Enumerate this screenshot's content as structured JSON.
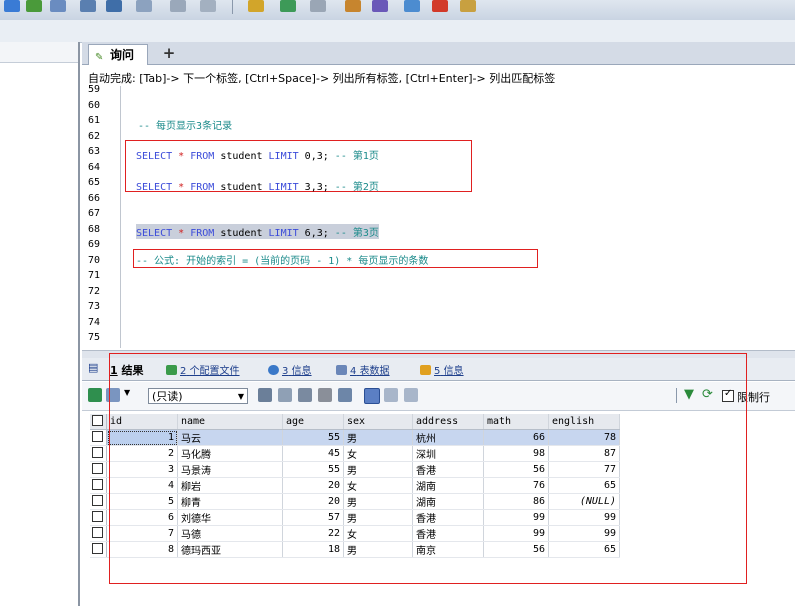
{
  "toolbar": {
    "icons": [
      "db-icon",
      "connect-icon",
      "table-icon",
      "query-icon",
      "backup-icon",
      "restore-icon",
      "schema-icon",
      "check-icon",
      "refresh-icon",
      "grid-icon",
      "user-icon",
      "tools-icon",
      "pdf-icon",
      "chart-icon"
    ]
  },
  "editor": {
    "tab_label": "询问",
    "add_tab": "+",
    "hint": "自动完成: [Tab]-> 下一个标签, [Ctrl+Space]-> 列出所有标签, [Ctrl+Enter]-> 列出匹配标签",
    "line_numbers": [
      "59",
      "60",
      "61",
      "62",
      "63",
      "64",
      "65",
      "66",
      "67",
      "68",
      "69",
      "70",
      "71",
      "72",
      "73",
      "74",
      "75"
    ],
    "comment_line": "-- 每页显示3条记录",
    "q1": {
      "select": "SELECT",
      "star": "*",
      "from": "FROM",
      "table": "student",
      "limit": "LIMIT",
      "args": "0,3;",
      "comment": "-- 第1页"
    },
    "q2": {
      "select": "SELECT",
      "star": "*",
      "from": "FROM",
      "table": "student",
      "limit": "LIMIT",
      "args": "3,3;",
      "comment": "-- 第2页"
    },
    "q3": {
      "select": "SELECT",
      "star": "*",
      "from": "FROM",
      "table": "student",
      "limit": "LIMIT",
      "args": "6,3;",
      "comment": "-- 第3页"
    },
    "formula": "-- 公式: 开始的索引 = (当前的页码 - 1) * 每页显示的条数"
  },
  "results_tabs": [
    {
      "num": "1",
      "label": "结果",
      "active": true
    },
    {
      "num": "2",
      "label": "个配置文件"
    },
    {
      "num": "3",
      "label": "信息"
    },
    {
      "num": "4",
      "label": "表数据"
    },
    {
      "num": "5",
      "label": "信息"
    }
  ],
  "grid_toolbar": {
    "mode_select": "(只读)",
    "limit_label": "限制行"
  },
  "table": {
    "columns": [
      "id",
      "name",
      "age",
      "sex",
      "address",
      "math",
      "english"
    ],
    "rows": [
      [
        "1",
        "马云",
        "55",
        "男",
        "杭州",
        "66",
        "78"
      ],
      [
        "2",
        "马化腾",
        "45",
        "女",
        "深圳",
        "98",
        "87"
      ],
      [
        "3",
        "马景涛",
        "55",
        "男",
        "香港",
        "56",
        "77"
      ],
      [
        "4",
        "柳岩",
        "20",
        "女",
        "湖南",
        "76",
        "65"
      ],
      [
        "5",
        "柳青",
        "20",
        "男",
        "湖南",
        "86",
        "(NULL)"
      ],
      [
        "6",
        "刘德华",
        "57",
        "男",
        "香港",
        "99",
        "99"
      ],
      [
        "7",
        "马德",
        "22",
        "女",
        "香港",
        "99",
        "99"
      ],
      [
        "8",
        "德玛西亚",
        "18",
        "男",
        "南京",
        "56",
        "65"
      ]
    ]
  },
  "colors": {
    "highlight_box": "#e02020",
    "keyword": "#3b4bd9",
    "comment": "#1a8a8a"
  }
}
